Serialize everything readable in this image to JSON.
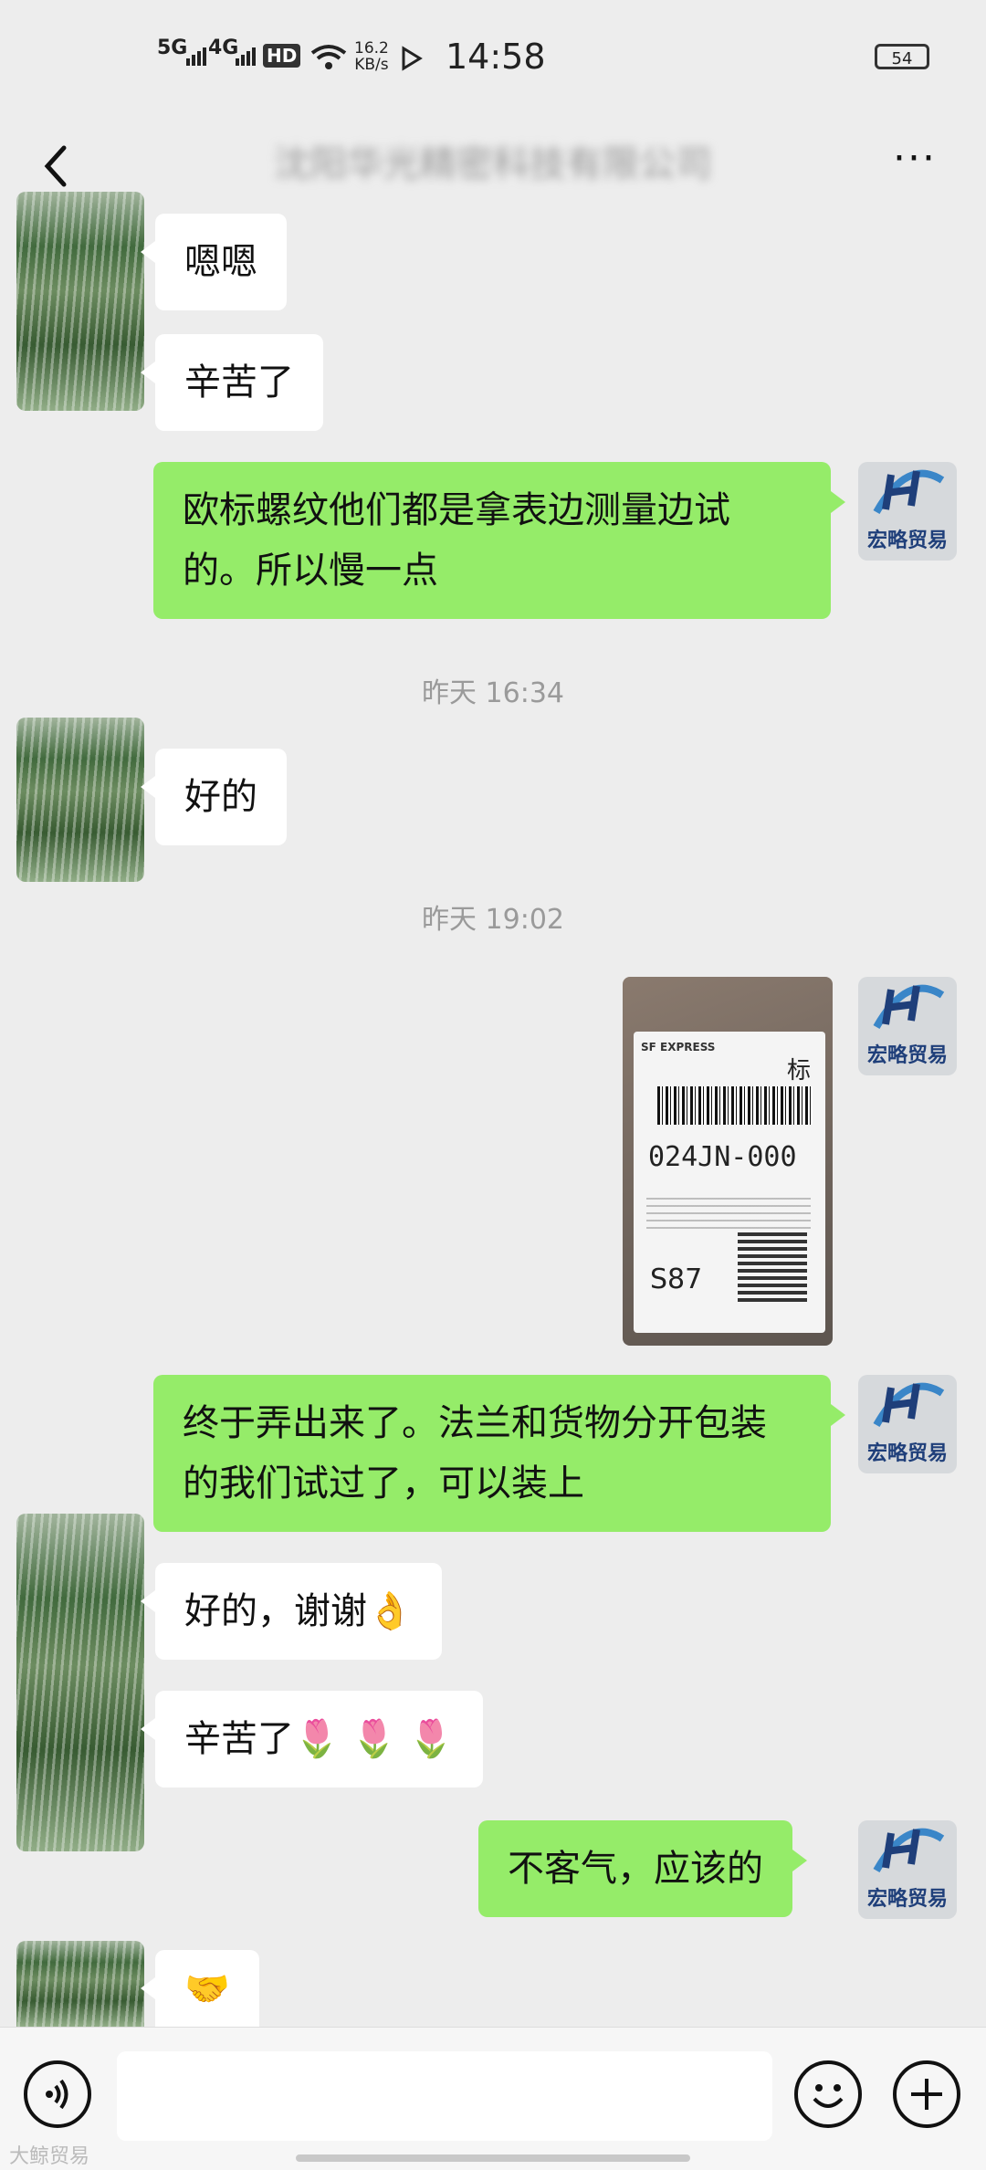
{
  "status_bar": {
    "net1": "5G",
    "net2": "4G",
    "hd": "HD",
    "speed_value": "16.2",
    "speed_unit": "KB/s",
    "time": "14:58",
    "battery": "54"
  },
  "header": {
    "title": "沈阳华光精密科技有限公司",
    "back_icon": "chevron-left-icon",
    "more_icon": "more-dots-icon"
  },
  "contact_logo_text": "宏略贸易",
  "messages": {
    "m1": "嗯嗯",
    "m2": "辛苦了",
    "m3": "欧标螺纹他们都是拿表边测量边试的。所以慢一点",
    "ts1": "昨天 16:34",
    "m4": "好的",
    "ts2": "昨天 19:02",
    "m5": "终于弄出来了。法兰和货物分开包装的我们试过了，可以装上",
    "m6": "好的，谢谢",
    "m6_emoji": "👌",
    "m7": "辛苦了",
    "m7_emoji": "🌷 🌷 🌷",
    "m8": "不客气，应该的",
    "m9_emoji": "🤝"
  },
  "image_message": {
    "brand": "SF EXPRESS",
    "tag": "标快",
    "code": "024JN-000",
    "route": "S87"
  },
  "input_bar": {
    "voice_icon": "voice-icon",
    "emoji_icon": "emoji-icon",
    "plus_icon": "plus-icon",
    "placeholder": ""
  },
  "watermark": "大鲸贸易"
}
